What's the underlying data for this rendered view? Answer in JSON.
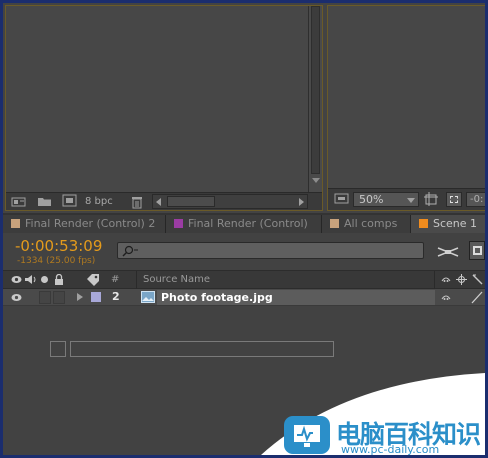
{
  "project_panel": {
    "bit_depth": "8 bpc",
    "icons": [
      "interpret-footage-icon",
      "new-folder-icon",
      "new-composition-icon",
      "trash-icon",
      "scroll-left-icon",
      "scroll-right-icon",
      "scroll-down-icon"
    ]
  },
  "composition_panel": {
    "zoom": "50%",
    "icons": [
      "monitor-icon",
      "zoom-dropdown-icon",
      "resolution-icon",
      "region-of-interest-icon",
      "camera-icon"
    ]
  },
  "tabs": [
    {
      "label": "Final Render (Control) 2",
      "color": "#c8a27c"
    },
    {
      "label": "Final Render (Control)",
      "color": "#9b3ca3"
    },
    {
      "label": "All comps",
      "color": "#c8a27c"
    },
    {
      "label": "Scene 1",
      "color": "#f08c1e"
    }
  ],
  "timeline": {
    "timecode": "-0:00:53:09",
    "frames": "-1334 (25.00 fps)",
    "search_placeholder": "",
    "header": {
      "number_col": "#",
      "source_col": "Source Name"
    },
    "layers": [
      {
        "number": "2",
        "name": "Photo footage.jpg",
        "label_color": "#a8a8d8"
      }
    ]
  },
  "watermark": {
    "title": "电脑百科知识",
    "url": "www.pc-daily.com",
    "color": "#2b8fc9"
  }
}
